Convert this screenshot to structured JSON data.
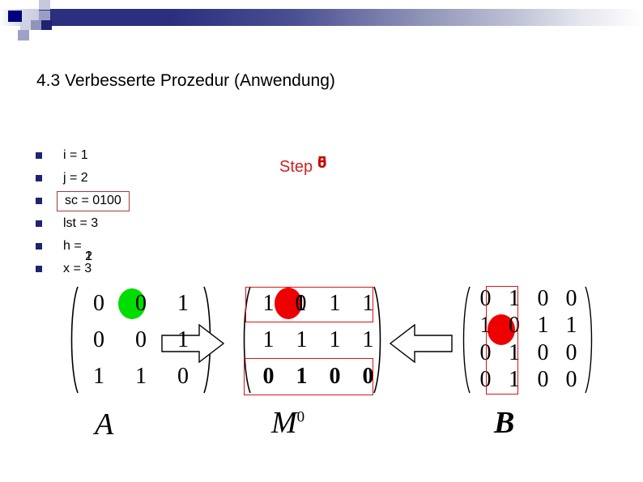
{
  "header": {
    "decoration_colors": {
      "navy": "#000080",
      "bar_dark": "#2b2f7e",
      "lavender": "#9a9ec4"
    }
  },
  "title": "4.3 Verbesserte Prozedur (Anwendung)",
  "bullets": [
    {
      "text": "i = 1",
      "boxed": false
    },
    {
      "text": "j = 2",
      "boxed": false
    },
    {
      "text": "sc = 0100",
      "boxed": true
    },
    {
      "text": "lst = 3",
      "boxed": false
    },
    {
      "prefix": "h = ",
      "overlap": [
        "1",
        "2"
      ],
      "boxed": false
    },
    {
      "text": "x = 3",
      "boxed": false
    }
  ],
  "step": {
    "label": "Step",
    "overlap_digits": [
      "5",
      "6",
      "0"
    ],
    "color": "#cc0000"
  },
  "matrices": [
    {
      "name": "A",
      "label": "A",
      "superscript": "",
      "rows": [
        [
          "0",
          "0",
          "1"
        ],
        [
          "0",
          "0",
          "1"
        ],
        [
          "1",
          "1",
          "0"
        ]
      ],
      "highlight": {
        "row": 0,
        "col": 2,
        "color": "#00dd00",
        "shape": "ellipse"
      }
    },
    {
      "name": "M",
      "label": "M",
      "superscript": "0",
      "rows": [
        [
          "1",
          "0",
          "1",
          "1"
        ],
        [
          "1",
          "1",
          "1",
          "1"
        ],
        [
          "0",
          "1",
          "0",
          "0"
        ]
      ],
      "bold_rows": [
        2
      ],
      "highlight": {
        "row": 0,
        "col": 1,
        "color": "#ee0000",
        "shape": "ellipse",
        "overlap": [
          "0",
          "1"
        ]
      },
      "row_boxes": [
        0,
        2
      ]
    },
    {
      "name": "B",
      "label": "B",
      "superscript": "",
      "rows": [
        [
          "0",
          "1",
          "0",
          "0"
        ],
        [
          "1",
          "0",
          "1",
          "1"
        ],
        [
          "0",
          "1",
          "0",
          "0"
        ],
        [
          "0",
          "1",
          "0",
          "0"
        ]
      ],
      "highlight": {
        "row": 1,
        "col": 1,
        "color": "#ee0000",
        "shape": "ellipse"
      },
      "col_boxes": [
        1
      ]
    }
  ],
  "arrows": [
    {
      "name": "arrow-a-to-m",
      "direction": "right"
    },
    {
      "name": "arrow-b-to-m",
      "direction": "left"
    }
  ]
}
